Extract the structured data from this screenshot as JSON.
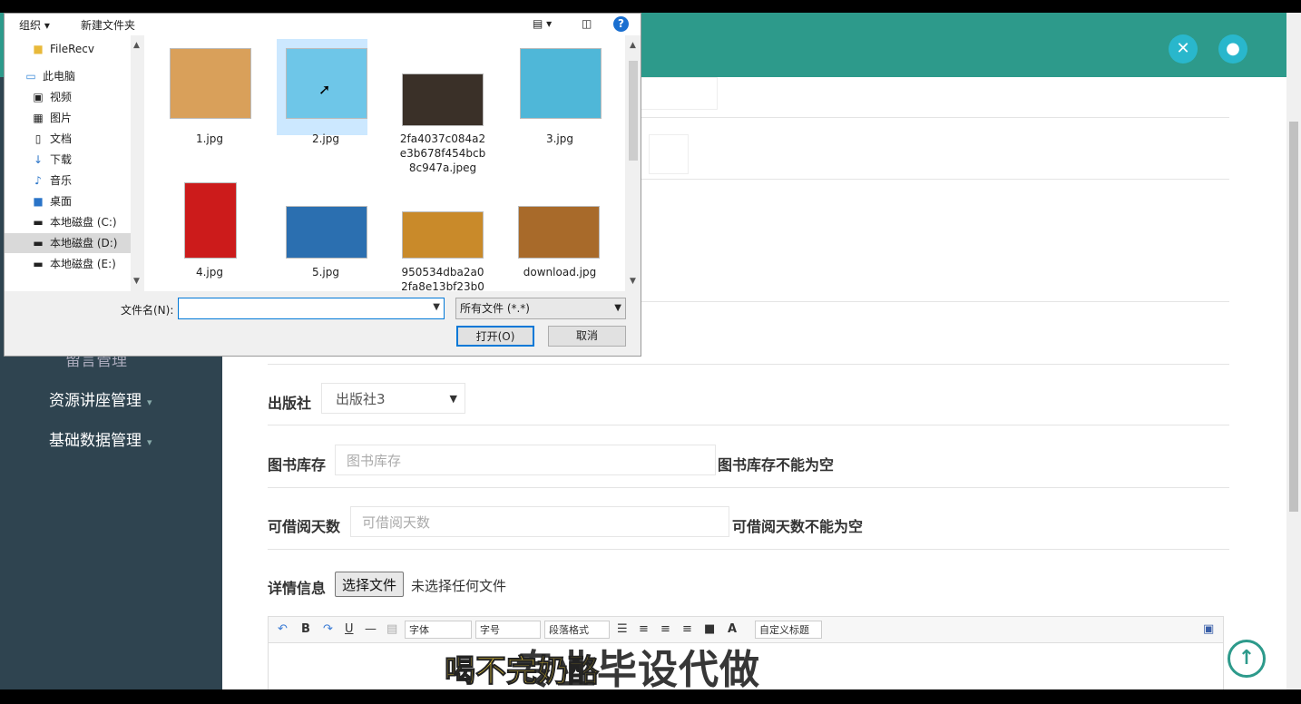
{
  "header": {
    "fullscreen_icon": "expand-icon",
    "user_icon": "user-icon"
  },
  "sidebar": {
    "items": [
      {
        "label": "留言管理"
      },
      {
        "label": "资源讲座管理"
      },
      {
        "label": "基础数据管理"
      }
    ]
  },
  "form": {
    "publisher": {
      "label": "出版社",
      "value": "出版社3"
    },
    "stock": {
      "label": "图书库存",
      "placeholder": "图书库存",
      "error": "图书库存不能为空"
    },
    "borrow_days": {
      "label": "可借阅天数",
      "placeholder": "可借阅天数",
      "error": "可借阅天数不能为空"
    },
    "detail": {
      "label": "详情信息",
      "choose_file": "选择文件",
      "no_file": "未选择任何文件"
    }
  },
  "editor_toolbar": {
    "font_label": "字体",
    "size_label": "字号",
    "paragraph_label": "段落格式",
    "custom_title_label": "自定义标题"
  },
  "subtitles": {
    "line1": "专业毕设代做",
    "line2": "喝不完奶酪"
  },
  "file_dialog": {
    "toolbar": {
      "organize": "组织 ▾",
      "new_folder": "新建文件夹",
      "help": "?"
    },
    "tree": [
      {
        "label": "FileRecv",
        "icon": "folder-icon"
      },
      {
        "label": "此电脑",
        "icon": "computer-icon"
      },
      {
        "label": "视频",
        "icon": "video-icon"
      },
      {
        "label": "图片",
        "icon": "picture-icon"
      },
      {
        "label": "文档",
        "icon": "document-icon"
      },
      {
        "label": "下载",
        "icon": "download-icon"
      },
      {
        "label": "音乐",
        "icon": "music-icon"
      },
      {
        "label": "桌面",
        "icon": "desktop-icon"
      },
      {
        "label": "本地磁盘 (C:)",
        "icon": "drive-icon"
      },
      {
        "label": "本地磁盘 (D:)",
        "icon": "drive-icon"
      },
      {
        "label": "本地磁盘 (E:)",
        "icon": "drive-icon"
      }
    ],
    "files": [
      {
        "name": "1.jpg",
        "color": "#d9a05a"
      },
      {
        "name": "2.jpg",
        "color": "#6ec6e8"
      },
      {
        "name": "2fa4037c084a2 e3b678f454bcb 8c947a.jpeg",
        "color": "#3a3028"
      },
      {
        "name": "3.jpg",
        "color": "#4fb7d8"
      },
      {
        "name": "4.jpg",
        "color": "#cc1b1b"
      },
      {
        "name": "5.jpg",
        "color": "#2b6fb0"
      },
      {
        "name": "950534dba2a0 2fa8e13bf23b0",
        "color": "#c98a2a"
      },
      {
        "name": "download.jpg",
        "color": "#a86a2a"
      }
    ],
    "filename_label": "文件名(N):",
    "filetype_value": "所有文件 (*.*)",
    "open_button": "打开(O)",
    "cancel_button": "取消"
  }
}
